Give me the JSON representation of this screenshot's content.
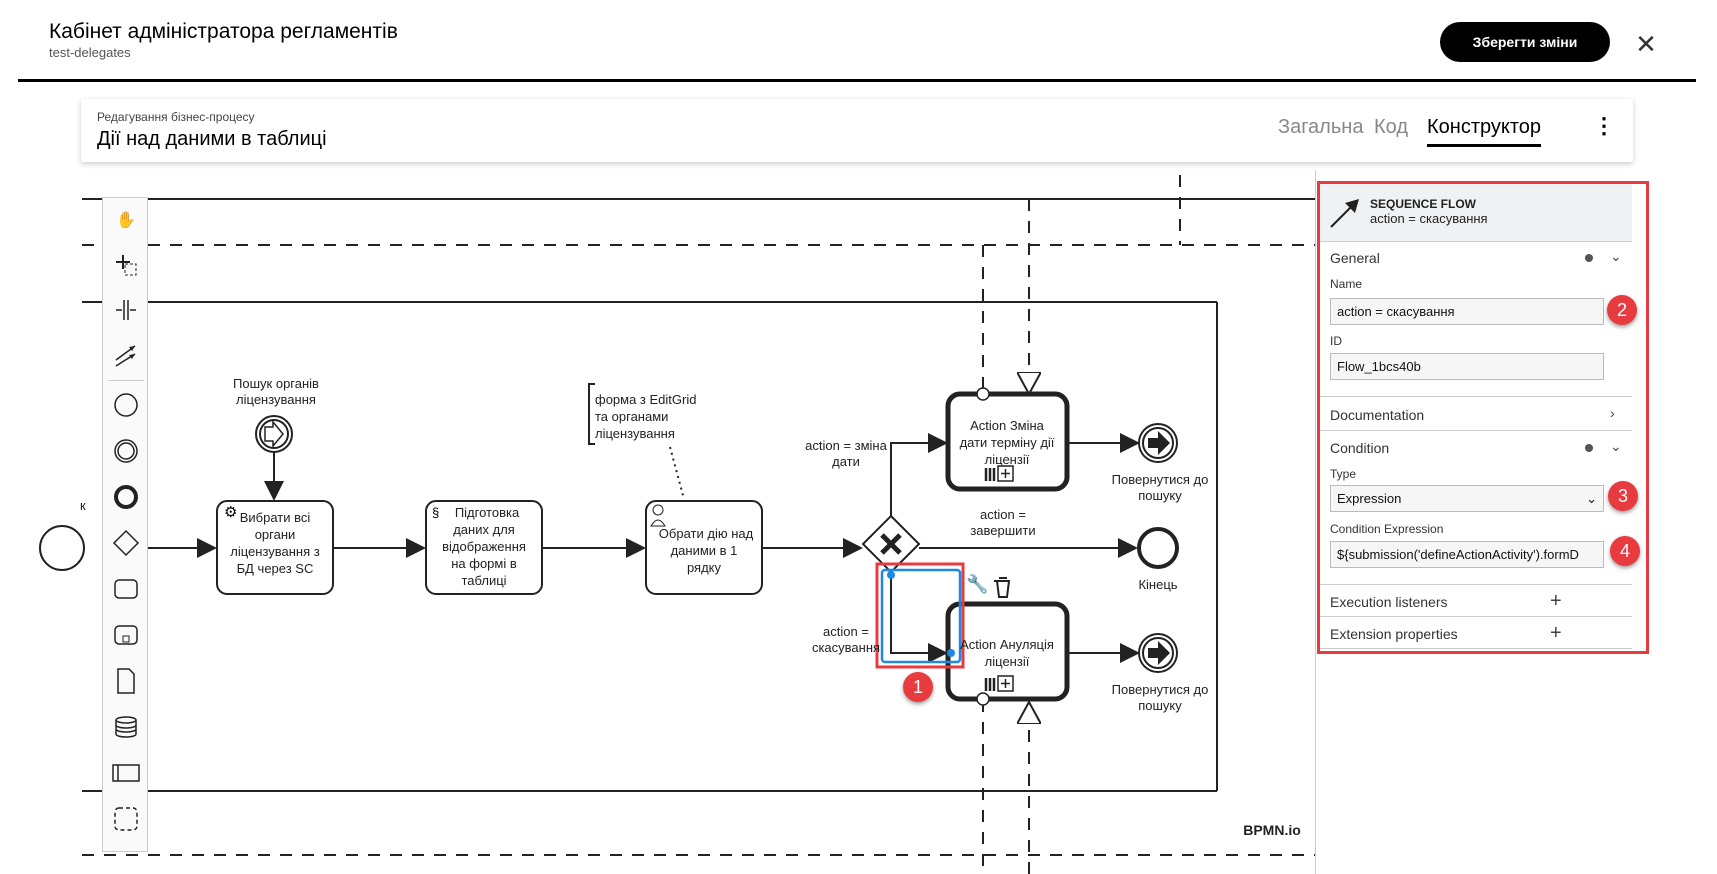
{
  "header": {
    "title": "Кабінет адміністратора регламентів",
    "subtitle": "test-delegates",
    "save_label": "Зберегти зміни",
    "close_icon": "close-icon"
  },
  "card": {
    "subtitle": "Редагування бізнес-процесу",
    "title": "Дії над даними в таблиці",
    "tabs": [
      {
        "label": "Загальна",
        "active": false
      },
      {
        "label": "Код",
        "active": false
      },
      {
        "label": "Конструктор",
        "active": true
      }
    ],
    "more_icon": "kebab-icon"
  },
  "palette": [
    "hand-tool",
    "lasso-tool",
    "space-tool",
    "connect-tool",
    "start-event",
    "intermediate-event",
    "end-event",
    "gateway",
    "task",
    "subprocess",
    "data-object",
    "data-store",
    "pool",
    "group"
  ],
  "diagram": {
    "start_label_fragment": "к",
    "intermediate_event": [
      "Пошук органів",
      "ліцензування"
    ],
    "task1": [
      "Вибрати всі",
      "органи",
      "ліцензування з",
      "БД через SC"
    ],
    "task2": [
      "Підготовка",
      "даних для",
      "відображення",
      "на формі в",
      "таблиці"
    ],
    "task3": [
      "Обрати дію над",
      "даними в 1",
      "рядку"
    ],
    "annotation": [
      "форма з EditGrid",
      "та органами",
      "ліцензування"
    ],
    "flow_change": [
      "action = зміна",
      "дати"
    ],
    "flow_finish": [
      "action =",
      "завершити"
    ],
    "flow_cancel": [
      "action =",
      "скасування"
    ],
    "task_change": [
      "Action Зміна",
      "дати терміну дії",
      "ліцензії"
    ],
    "task_cancel": [
      "Action Ануляція",
      "ліцензії"
    ],
    "end_return1": [
      "Повернутися до",
      "пошуку"
    ],
    "end_return2": [
      "Повернутися до",
      "пошуку"
    ],
    "end": "Кінець",
    "watermark": "BPMN.io"
  },
  "panel": {
    "type": "SEQUENCE FLOW",
    "name": "action = скасування",
    "general": "General",
    "name_label": "Name",
    "name_value": "action = скасування",
    "id_label": "ID",
    "id_value": "Flow_1bcs40b",
    "documentation": "Documentation",
    "condition": "Condition",
    "type_label": "Type",
    "type_value": "Expression",
    "expr_label": "Condition Expression",
    "expr_value": "${submission('defineActionActivity').formD",
    "exec_listeners": "Execution listeners",
    "ext_props": "Extension properties"
  },
  "badges": [
    "1",
    "2",
    "3",
    "4"
  ],
  "colors": {
    "highlight": "#e83b40",
    "selection": "#1e88e5"
  }
}
